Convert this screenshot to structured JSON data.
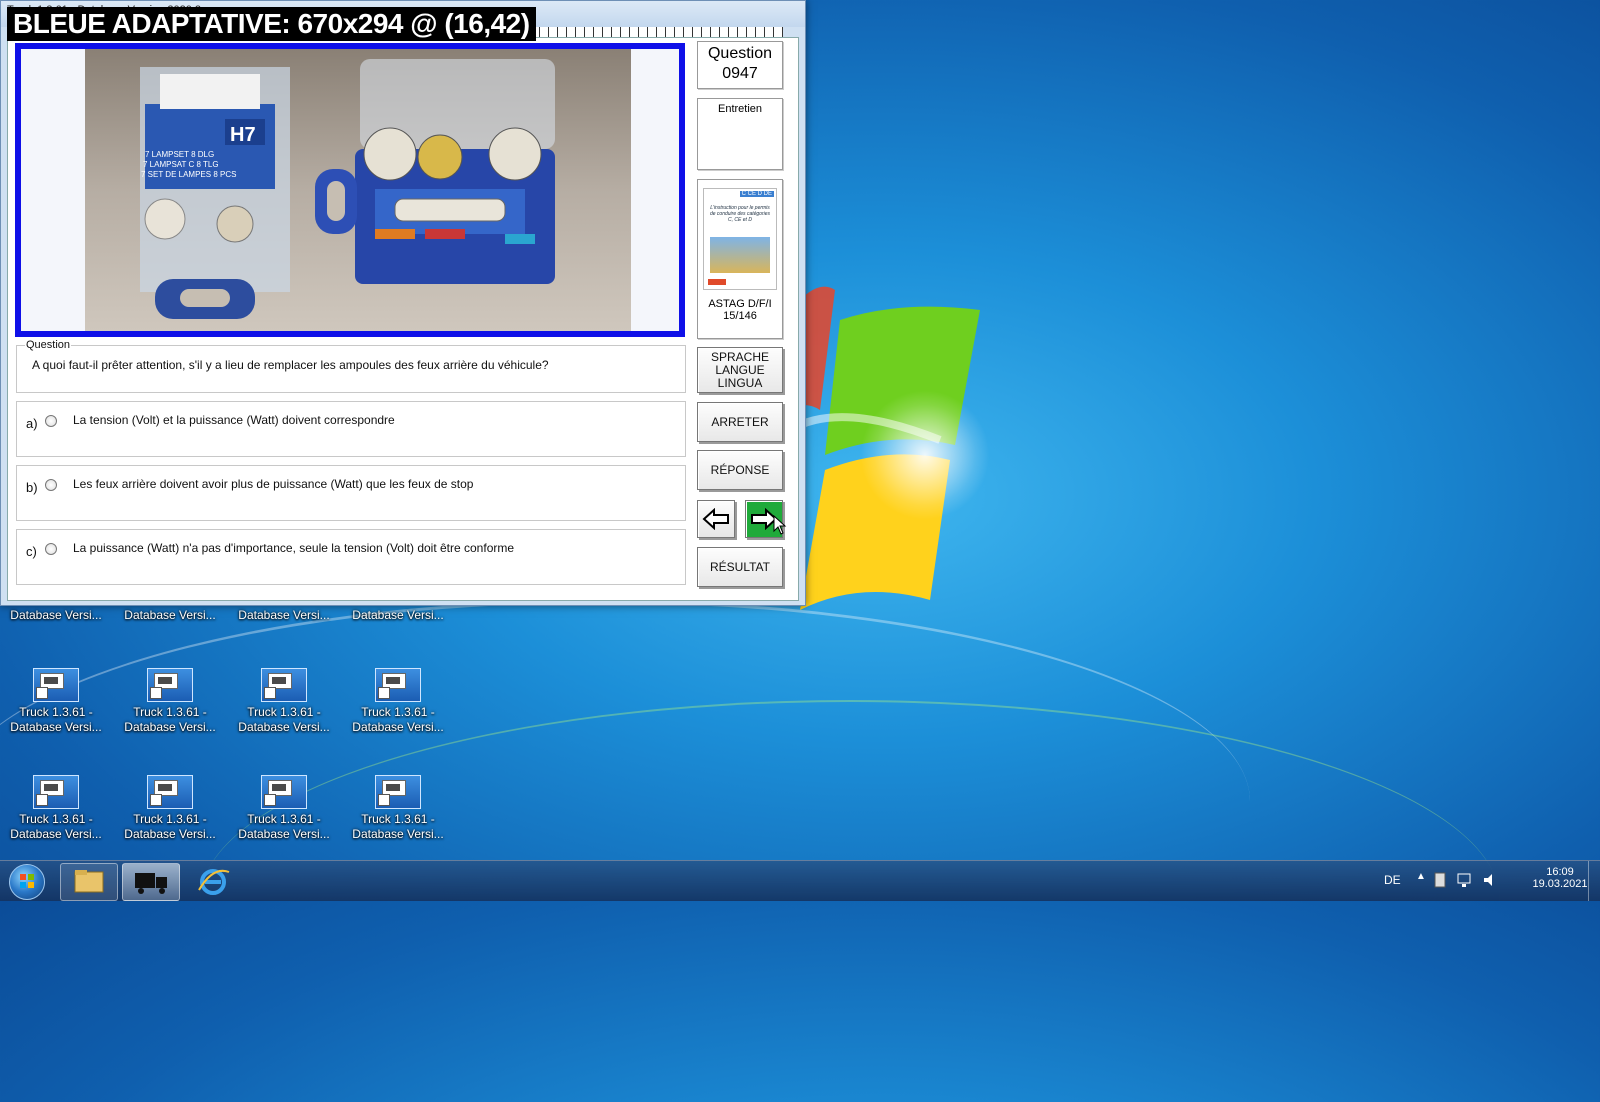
{
  "window": {
    "title": "Truck 1.3.61 - Database Version 2020.2",
    "overlay_label": "BLEUE ADAPTATIVE: 670x294 @ (16,42)"
  },
  "question_panel": {
    "title_line1": "Question",
    "number": "0947",
    "category": "Entretien",
    "book_title": "ASTAG D/F/I",
    "book_page": "15/146",
    "book_cover_badges": "C CE D DE",
    "book_cover_text": "L'instruction pour le permis de conduire des catégories C, CE et D"
  },
  "question": {
    "legend": "Question",
    "text": "A quoi faut-il prêter attention, s'il y a lieu de remplacer les ampoules des feux arrière du véhicule?"
  },
  "answers": [
    {
      "letter": "a)",
      "text": "La tension (Volt) et la puissance (Watt) doivent correspondre"
    },
    {
      "letter": "b)",
      "text": "Les feux arrière doivent avoir plus de puissance (Watt) que les feux de stop"
    },
    {
      "letter": "c)",
      "text": "La puissance (Watt) n'a pas d'importance, seule la tension (Volt) doit être conforme"
    }
  ],
  "buttons": {
    "language_line1": "SPRACHE",
    "language_line2": "LANGUE",
    "language_line3": "LINGUA",
    "stop": "ARRETER",
    "answer": "RÉPONSE",
    "result": "RÉSULTAT"
  },
  "photo": {
    "box_label": "H7",
    "box_text_lines": [
      "7 LAMPSET 8 DLG",
      "7 LAMPSAT C 8 TLG",
      "7 SET DE LAMPES 8 PCS"
    ]
  },
  "desktop_icons": [
    {
      "line1": "",
      "line2": "Database Versi..."
    },
    {
      "line1": "",
      "line2": "Database Versi..."
    },
    {
      "line1": "",
      "line2": "Database Versi..."
    },
    {
      "line1": "",
      "line2": "Database Versi..."
    },
    {
      "line1": "Truck 1.3.61 -",
      "line2": "Database Versi..."
    },
    {
      "line1": "Truck 1.3.61 -",
      "line2": "Database Versi..."
    },
    {
      "line1": "Truck 1.3.61 -",
      "line2": "Database Versi..."
    },
    {
      "line1": "Truck 1.3.61 -",
      "line2": "Database Versi..."
    },
    {
      "line1": "Truck 1.3.61 -",
      "line2": "Database Versi..."
    },
    {
      "line1": "Truck 1.3.61 -",
      "line2": "Database Versi..."
    },
    {
      "line1": "Truck 1.3.61 -",
      "line2": "Database Versi..."
    },
    {
      "line1": "Truck 1.3.61 -",
      "line2": "Database Versi..."
    }
  ],
  "taskbar": {
    "language": "DE",
    "time": "16:09",
    "date": "19.03.2021",
    "pinned": [
      "windows-explorer",
      "truck-app",
      "internet-explorer"
    ]
  },
  "colors": {
    "image_frame": "#0f10e8",
    "next_button": "#1faa3a",
    "overlay_bg": "#000000"
  }
}
